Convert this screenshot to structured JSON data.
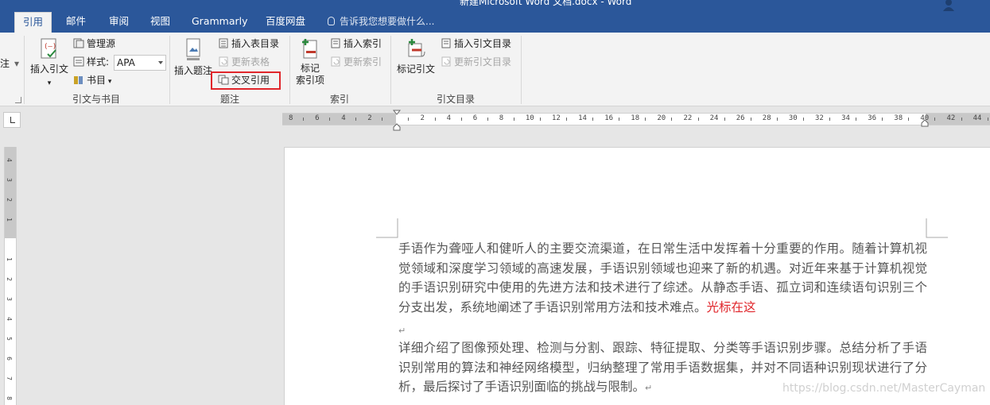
{
  "window": {
    "title": "新建Microsoft Word 文档.docx - Word"
  },
  "tabs": [
    {
      "label": "引用"
    },
    {
      "label": "邮件"
    },
    {
      "label": "审阅"
    },
    {
      "label": "视图"
    },
    {
      "label": "Grammarly"
    },
    {
      "label": "百度网盘"
    }
  ],
  "tell_me": {
    "placeholder": "告诉我您想要做什么..."
  },
  "ribbon": {
    "left_cut_label": "注",
    "citations": {
      "insert_citation": "插入引文",
      "manage_sources": "管理源",
      "style_label": "样式:",
      "style_value": "APA",
      "bibliography": "书目",
      "group_label": "引文与书目"
    },
    "captions": {
      "insert_caption": "插入题注",
      "insert_table_of_figures": "插入表目录",
      "update_table": "更新表格",
      "cross_reference": "交叉引用",
      "group_label": "题注"
    },
    "index": {
      "mark_entry": "标记\n索引项",
      "insert_index": "插入索引",
      "update_index": "更新索引",
      "group_label": "索引"
    },
    "authorities": {
      "mark_citation": "标记引文",
      "insert_table_of_authorities": "插入引文目录",
      "update_table": "更新引文目录",
      "group_label": "引文目录"
    }
  },
  "document": {
    "paragraph1": "手语作为聋哑人和健听人的主要交流渠道，在日常生活中发挥着十分重要的作用。随着计算机视觉领域和深度学习领域的高速发展，手语识别领域也迎来了新的机遇。对近年来基于计算机视觉的手语识别研究中使用的先进方法和技术进行了综述。从静态手语、孤立词和连续语句识别三个分支出发，系统地阐述了手语识别常用方法和技术难点。",
    "cursor_note": "光标在这",
    "paragraph_mark": "↵",
    "paragraph2": "详细介绍了图像预处理、检测与分割、跟踪、特征提取、分类等手语识别步骤。总结分析了手语识别常用的算法和神经网络模型，归纳整理了常用手语数据集，并对不同语种识别现状进行了分析，最后探讨了手语识别面临的挑战与限制。"
  },
  "watermark": "https://blog.csdn.net/MasterCayman",
  "colors": {
    "title_bar": "#2b579a",
    "ribbon": "#f3f3f3",
    "highlight_box": "#e0262b",
    "cursor_note": "#e0262b"
  }
}
